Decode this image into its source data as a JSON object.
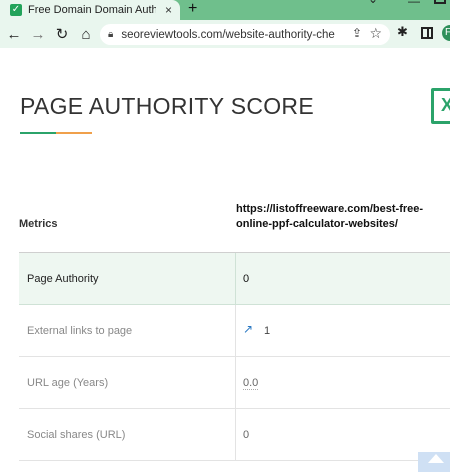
{
  "browser": {
    "tab_title": "Free Domain Domain Authority C",
    "tab_close": "×",
    "new_tab": "+",
    "url": "seoreviewtools.com/website-authority-check...",
    "profile_initial": "F"
  },
  "icons": {
    "back": "back-arrow-icon",
    "forward": "forward-arrow-icon",
    "reload": "reload-icon",
    "home": "home-icon",
    "lock": "lock-icon",
    "share": "share-icon",
    "star": "star-icon",
    "extensions": "puzzle-icon",
    "side_panel": "side-panel-icon",
    "excel": "excel-icon",
    "external_link": "external-link-icon"
  },
  "colors": {
    "accent_green": "#2ba36a",
    "accent_orange": "#f0a04b",
    "row_highlight": "#eef7f1"
  },
  "page": {
    "heading": "PAGE AUTHORITY SCORE",
    "excel_letter": "X"
  },
  "table": {
    "metrics_header": "Metrics",
    "site_header": "https://listoffreeware.com/best-free-online-ppf-calculator-websites/",
    "rows": [
      {
        "label": "Page Authority",
        "value": "0"
      },
      {
        "label": "External links to page",
        "value": "1"
      },
      {
        "label": "URL age (Years)",
        "value": "0.0"
      },
      {
        "label": "Social shares (URL)",
        "value": "0"
      }
    ]
  }
}
